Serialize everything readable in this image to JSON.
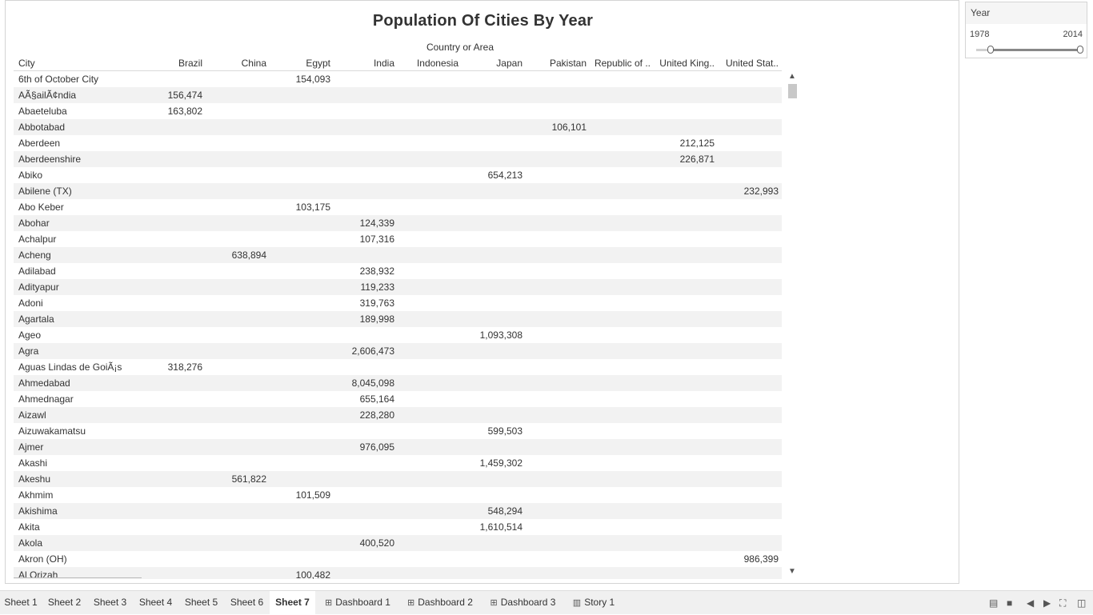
{
  "title": "Population Of Cities By Year",
  "column_group_label": "Country or Area",
  "row_header": "City",
  "columns": [
    "Brazil",
    "China",
    "Egypt",
    "India",
    "Indonesia",
    "Japan",
    "Pakistan",
    "Republic of ..",
    "United King..",
    "United Stat.."
  ],
  "rows": [
    {
      "city": "6th of October City",
      "col": 2,
      "value": "154,093"
    },
    {
      "city": "AÃ§ailÃ¢ndia",
      "col": 0,
      "value": "156,474"
    },
    {
      "city": "Abaeteluba",
      "col": 0,
      "value": "163,802"
    },
    {
      "city": "Abbotabad",
      "col": 6,
      "value": "106,101"
    },
    {
      "city": "Aberdeen",
      "col": 8,
      "value": "212,125"
    },
    {
      "city": "Aberdeenshire",
      "col": 8,
      "value": "226,871"
    },
    {
      "city": "Abiko",
      "col": 5,
      "value": "654,213"
    },
    {
      "city": "Abilene (TX)",
      "col": 9,
      "value": "232,993"
    },
    {
      "city": "Abo Keber",
      "col": 2,
      "value": "103,175"
    },
    {
      "city": "Abohar",
      "col": 3,
      "value": "124,339"
    },
    {
      "city": "Achalpur",
      "col": 3,
      "value": "107,316"
    },
    {
      "city": "Acheng",
      "col": 1,
      "value": "638,894"
    },
    {
      "city": "Adilabad",
      "col": 3,
      "value": "238,932"
    },
    {
      "city": "Adityapur",
      "col": 3,
      "value": "119,233"
    },
    {
      "city": "Adoni",
      "col": 3,
      "value": "319,763"
    },
    {
      "city": "Agartala",
      "col": 3,
      "value": "189,998"
    },
    {
      "city": "Ageo",
      "col": 5,
      "value": "1,093,308"
    },
    {
      "city": "Agra",
      "col": 3,
      "value": "2,606,473"
    },
    {
      "city": "Aguas Lindas de GoiÃ¡s",
      "col": 0,
      "value": "318,276"
    },
    {
      "city": "Ahmedabad",
      "col": 3,
      "value": "8,045,098"
    },
    {
      "city": "Ahmednagar",
      "col": 3,
      "value": "655,164"
    },
    {
      "city": "Aizawl",
      "col": 3,
      "value": "228,280"
    },
    {
      "city": "Aizuwakamatsu",
      "col": 5,
      "value": "599,503"
    },
    {
      "city": "Ajmer",
      "col": 3,
      "value": "976,095"
    },
    {
      "city": "Akashi",
      "col": 5,
      "value": "1,459,302"
    },
    {
      "city": "Akeshu",
      "col": 1,
      "value": "561,822"
    },
    {
      "city": "Akhmim",
      "col": 2,
      "value": "101,509"
    },
    {
      "city": "Akishima",
      "col": 5,
      "value": "548,294"
    },
    {
      "city": "Akita",
      "col": 5,
      "value": "1,610,514"
    },
    {
      "city": "Akola",
      "col": 3,
      "value": "400,520"
    },
    {
      "city": "Akron (OH)",
      "col": 9,
      "value": "986,399"
    },
    {
      "city": "Al Orizah",
      "col": 2,
      "value": "100,482"
    }
  ],
  "filter": {
    "title": "Year",
    "min": "1978",
    "max": "2014",
    "low_fraction": 0.14,
    "high_fraction": 1.0
  },
  "tabs": [
    {
      "label": "Sheet 1",
      "icon": ""
    },
    {
      "label": "Sheet 2",
      "icon": ""
    },
    {
      "label": "Sheet 3",
      "icon": ""
    },
    {
      "label": "Sheet 4",
      "icon": ""
    },
    {
      "label": "Sheet 5",
      "icon": ""
    },
    {
      "label": "Sheet 6",
      "icon": ""
    },
    {
      "label": "Sheet 7",
      "icon": "",
      "active": true
    },
    {
      "label": "Dashboard 1",
      "icon": "dashboard-icon"
    },
    {
      "label": "Dashboard 2",
      "icon": "dashboard-icon"
    },
    {
      "label": "Dashboard 3",
      "icon": "dashboard-icon"
    },
    {
      "label": "Story 1",
      "icon": "story-icon"
    }
  ],
  "toolbar_icons": [
    "show-filmstrip-icon",
    "show-tabs-icon",
    "previous-icon",
    "next-icon",
    "fullscreen-icon",
    "presentation-icon"
  ]
}
